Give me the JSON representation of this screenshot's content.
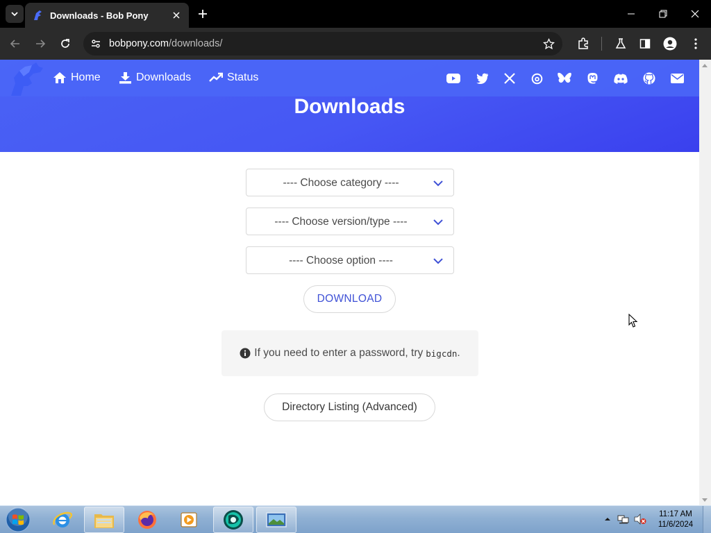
{
  "browser": {
    "tab_title": "Downloads - Bob Pony",
    "url_host": "bobpony.com",
    "url_path": "/downloads/"
  },
  "site": {
    "nav": [
      {
        "label": "Home",
        "icon": "home-icon"
      },
      {
        "label": "Downloads",
        "icon": "download-icon"
      },
      {
        "label": "Status",
        "icon": "trending-icon"
      }
    ],
    "social_icons": [
      "youtube-icon",
      "twitter-icon",
      "x-icon",
      "threads-icon",
      "bluesky-icon",
      "mastodon-icon",
      "discord-icon",
      "github-icon",
      "mail-icon"
    ],
    "hero_title": "Downloads",
    "brand_color": "#4a63f5"
  },
  "form": {
    "category_placeholder": "---- Choose category ----",
    "version_placeholder": "---- Choose version/type ----",
    "option_placeholder": "---- Choose option ----",
    "download_label": "DOWNLOAD",
    "notice_text": "If you need to enter a password, try",
    "notice_code": "bigcdn",
    "notice_end": ".",
    "directory_label": "Directory Listing (Advanced)"
  },
  "taskbar": {
    "time": "11:17 AM",
    "date": "11/6/2024"
  }
}
